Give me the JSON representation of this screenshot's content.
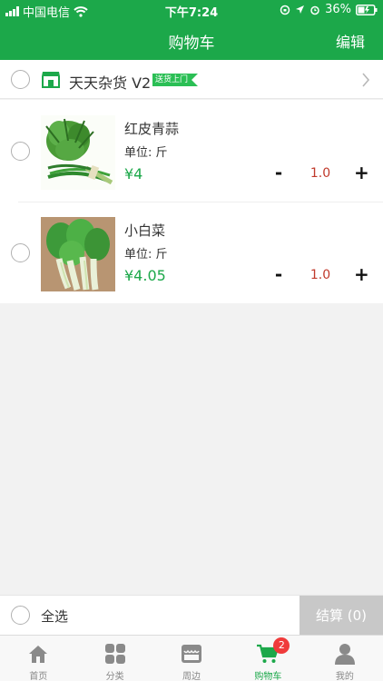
{
  "status_bar": {
    "carrier": "中国电信",
    "time": "下午7:24",
    "battery": "36%"
  },
  "header": {
    "title": "购物车",
    "edit_label": "编辑"
  },
  "store": {
    "name": "天天杂货 V2",
    "badge": "送货上门"
  },
  "products": [
    {
      "name": "红皮青蒜",
      "unit": "单位: 斤",
      "price": "¥4",
      "minus": "-",
      "qty": "1.0",
      "plus": "+"
    },
    {
      "name": "小白菜",
      "unit": "单位: 斤",
      "price": "¥4.05",
      "minus": "-",
      "qty": "1.0",
      "plus": "+"
    }
  ],
  "footer": {
    "select_all": "全选",
    "checkout": "结算 (0)"
  },
  "tabs": [
    {
      "label": "首页",
      "icon": "home-icon"
    },
    {
      "label": "分类",
      "icon": "category-grid-icon"
    },
    {
      "label": "周边",
      "icon": "nearby-store-icon"
    },
    {
      "label": "购物车",
      "icon": "cart-icon",
      "badge": "2",
      "active": true
    },
    {
      "label": "我的",
      "icon": "profile-icon"
    }
  ],
  "colors": {
    "brand_green": "#1ca84a",
    "price_green": "#1ca84a",
    "qty_red": "#c0392b",
    "badge_red": "#f03b3b",
    "checkout_gray": "#c8c8c8"
  }
}
